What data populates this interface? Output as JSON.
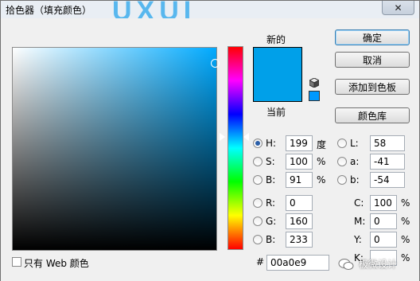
{
  "window": {
    "title": "拾色器（填充颜色）",
    "close_label": "✕",
    "title_art_text": "UXUI"
  },
  "colors": {
    "new": "#00a0e9",
    "current": "#00a0e9",
    "websafe": "#0099ff",
    "hue_base": "#00aaff"
  },
  "labels": {
    "new": "新的",
    "current": "当前",
    "web_only": "只有 Web 颜色",
    "hash": "#"
  },
  "buttons": {
    "ok": "确定",
    "cancel": "取消",
    "add_swatch": "添加到色板",
    "libraries": "颜色库"
  },
  "hsb": {
    "h": {
      "label": "H:",
      "value": "199",
      "unit": "度",
      "checked": true
    },
    "s": {
      "label": "S:",
      "value": "100",
      "unit": "%"
    },
    "b": {
      "label": "B:",
      "value": "91",
      "unit": "%"
    }
  },
  "rgb": {
    "r": {
      "label": "R:",
      "value": "0"
    },
    "g": {
      "label": "G:",
      "value": "160"
    },
    "b": {
      "label": "B:",
      "value": "233"
    }
  },
  "lab": {
    "l": {
      "label": "L:",
      "value": "58"
    },
    "a": {
      "label": "a:",
      "value": "-41"
    },
    "b": {
      "label": "b:",
      "value": "-54"
    }
  },
  "cmyk": {
    "c": {
      "label": "C:",
      "value": "100",
      "unit": "%"
    },
    "m": {
      "label": "M:",
      "value": "0",
      "unit": "%"
    },
    "y": {
      "label": "Y:",
      "value": "0",
      "unit": "%"
    },
    "k": {
      "label": "K:",
      "value": "",
      "unit": "%"
    }
  },
  "hex": "00a0e9",
  "watermark": "极微设计"
}
